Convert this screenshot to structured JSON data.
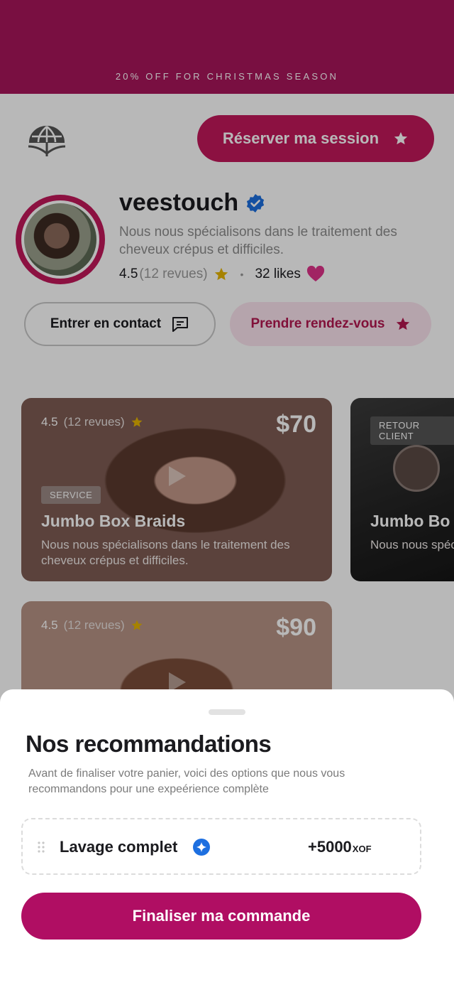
{
  "promo": {
    "text": "20% OFF FOR CHRISTMAS SEASON"
  },
  "header": {
    "logo_icon": "umbrella-globe-icon",
    "book_label": "Réserver ma session"
  },
  "profile": {
    "username": "veestouch",
    "bio": "Nous nous spécialisons dans le traitement des cheveux crépus et difficiles.",
    "rating": "4.5",
    "reviews": "(12 revues)",
    "likes": "32 likes",
    "contact_label": "Entrer en contact",
    "appointment_label": "Prendre rendez-vous"
  },
  "cards": [
    {
      "rating": "4.5",
      "reviews": "(12 revues)",
      "price": "$70",
      "tag": "SERVICE",
      "title": "Jumbo Box Braids",
      "description": "Nous nous spécialisons dans le traitement des cheveux crépus et difficiles."
    },
    {
      "tag": "RETOUR CLIENT",
      "title": "Jumbo Bo",
      "description": "Nous nous spéc cheveux crépus"
    },
    {
      "rating": "4.5",
      "reviews": "(12 revues)",
      "price": "$90"
    }
  ],
  "sheet": {
    "title": "Nos recommandations",
    "subtitle": "Avant de finaliser votre panier, voici des options que nous vous recommandons pour une expeérience complète",
    "item": {
      "name": "Lavage complet",
      "price": "+5000",
      "currency": "XOF"
    },
    "checkout_label": "Finaliser ma commande"
  },
  "colors": {
    "brand": "#c2185b",
    "promo_bg": "#a8155a",
    "checkout": "#b00e63",
    "accent_star": "#e6b400",
    "verified": "#1d6fe0"
  }
}
